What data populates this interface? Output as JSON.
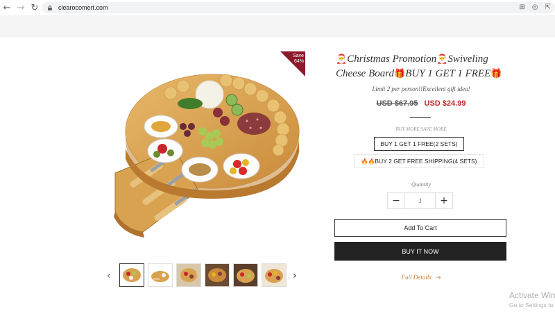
{
  "browser": {
    "url": "clearocomert.com",
    "icons": [
      "back-icon",
      "forward-icon",
      "reload-icon",
      "lock-icon",
      "translate-icon",
      "eye-off-icon",
      "share-icon"
    ]
  },
  "product": {
    "badge": {
      "line1": "Save",
      "line2": "64%"
    },
    "title_text_1": "Christmas Promotion",
    "title_text_2": "Swiveling Cheese Board",
    "title_text_3": "BUY 1 GET 1 FREE",
    "title_emoji_santa": "🎅",
    "title_emoji_gift": "🎁",
    "subtitle": "Limit 2 per person!!Excellent gift idea!",
    "old_price": "USD $67.95",
    "new_price": "USD $24.99",
    "bundle_heading": "BUY MORE SAVE MORE",
    "bundle_option_1": "BUY 1 GET 1 FREE(2 SETS)",
    "bundle_option_2_emoji": "🔥🔥",
    "bundle_option_2": "BUY 2 GET FREE SHIPPING(4 SETS)",
    "quantity_label": "Quantity",
    "quantity_value": "1",
    "add_to_cart": "Add To Cart",
    "buy_now": "BUY IT NOW",
    "full_details": "Full Details"
  },
  "thumbnails": {
    "prev_glyph": "‹",
    "next_glyph": "›",
    "count": 6
  },
  "windows_watermark": {
    "line1": "Activate Win",
    "line2": "Go to Settings to"
  },
  "colors": {
    "badge": "#8b1a2a",
    "sale_price": "#c0282c",
    "buy_now_bg": "#222222",
    "link_accent": "#c07f3c"
  }
}
